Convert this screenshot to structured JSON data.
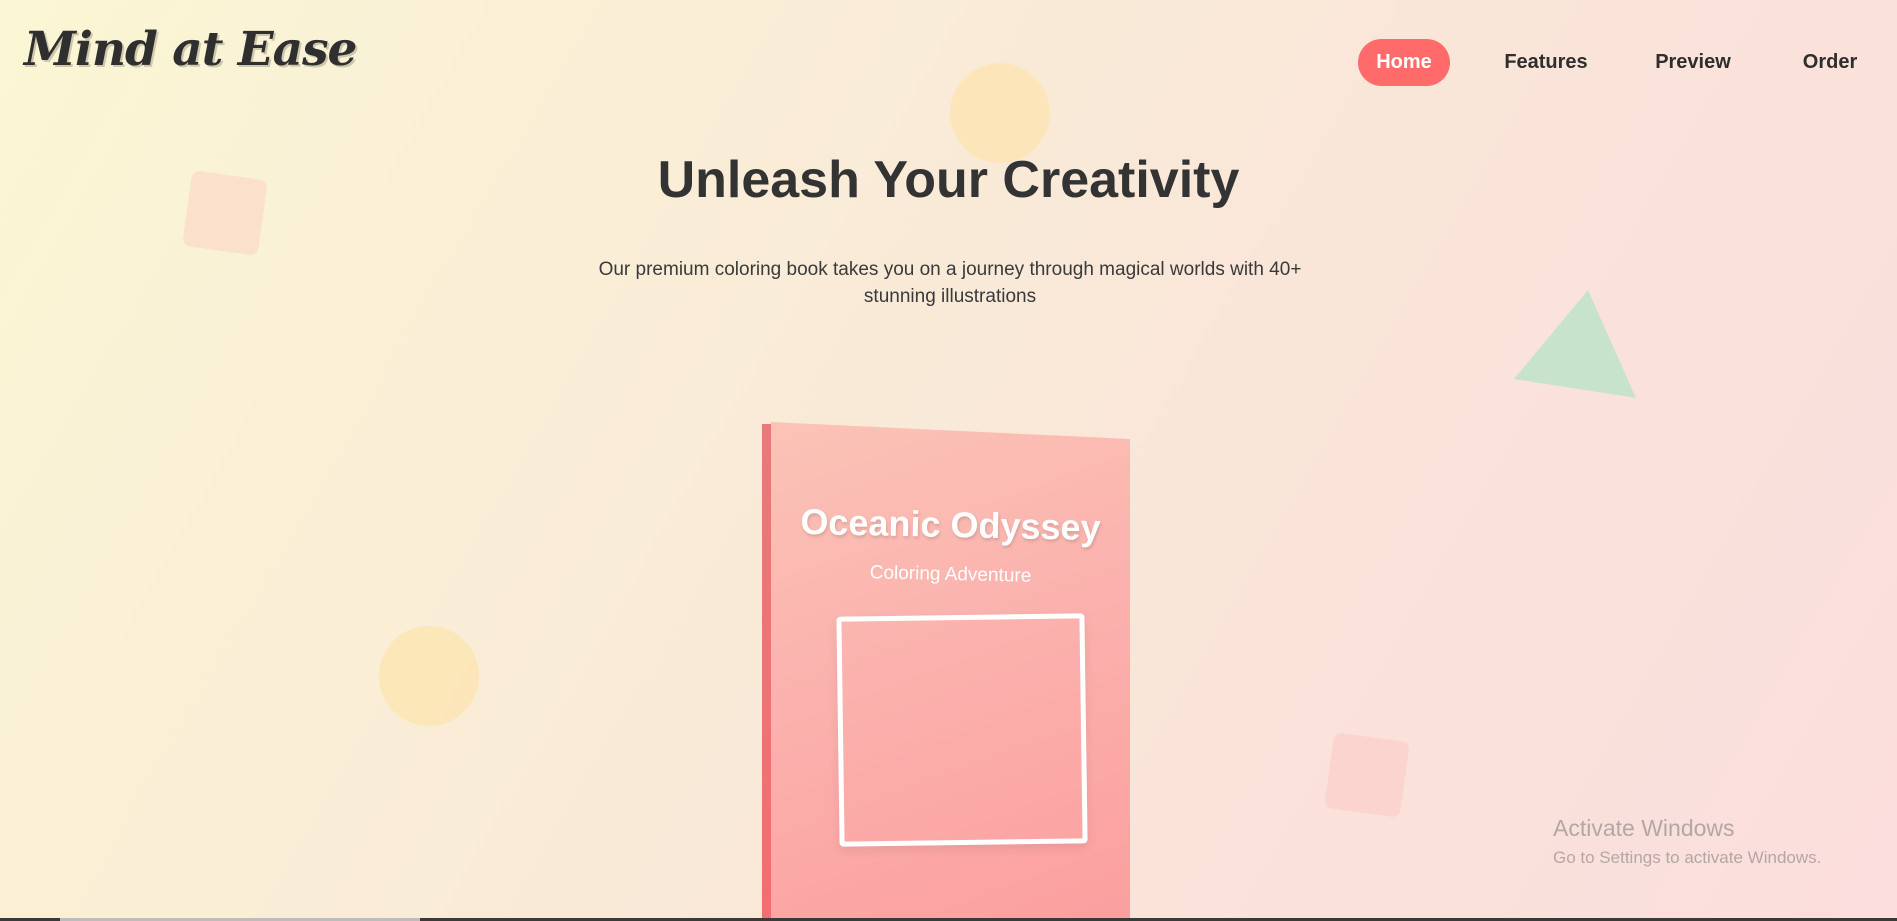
{
  "logo": {
    "text": "Mind at Ease"
  },
  "nav": {
    "items": [
      {
        "label": "Home",
        "active": true
      },
      {
        "label": "Features",
        "active": false
      },
      {
        "label": "Preview",
        "active": false
      },
      {
        "label": "Order",
        "active": false
      }
    ]
  },
  "hero": {
    "title": "Unleash Your Creativity",
    "subtitle": "Our premium coloring book takes you on a journey through magical worlds with 40+ stunning illustrations"
  },
  "book": {
    "title": "Oceanic Odyssey",
    "subtitle": "Coloring Adventure"
  },
  "windows_watermark": {
    "title": "Activate Windows",
    "subtitle": "Go to Settings to activate Windows."
  },
  "colors": {
    "accent": "#ff6b6b",
    "book_cover": "#fbb2ae",
    "triangle": "#c8e3cb",
    "circle": "#fce5b6",
    "square_orange": "#fbe0cc",
    "square_pink": "#fbd3cf"
  }
}
